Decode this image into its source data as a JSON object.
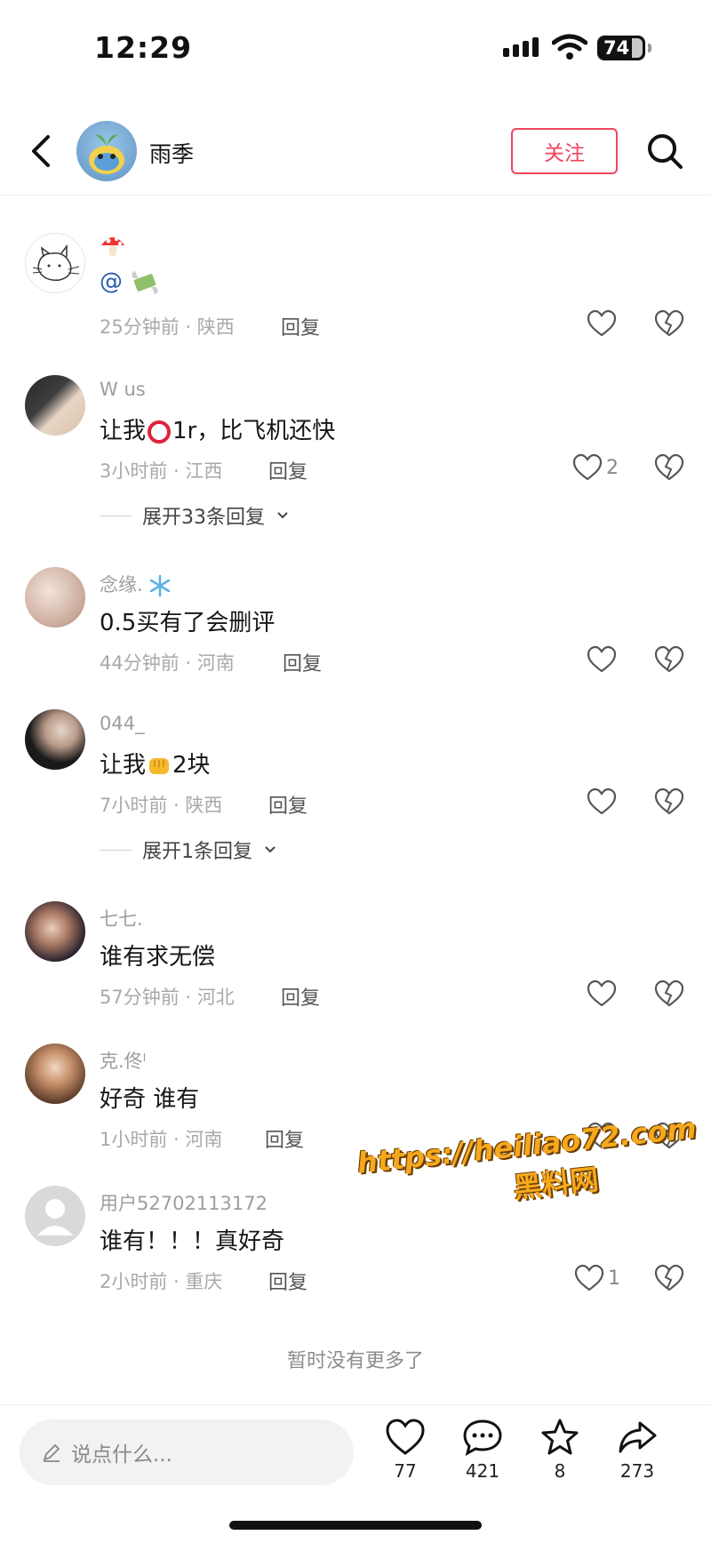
{
  "status_bar": {
    "time": "12:29",
    "battery": "74"
  },
  "header": {
    "username": "雨季",
    "follow_label": "关注"
  },
  "comments": [
    {
      "name": "",
      "text": "@",
      "time_location": "25分钟前 · 陕西",
      "reply_label": "回复",
      "likes": ""
    },
    {
      "name": "W us",
      "text_before": "让我",
      "text_after": "1r，比飞机还快",
      "time_location": "3小时前 · 江西",
      "reply_label": "回复",
      "likes": "2",
      "expand_label": "展开33条回复"
    },
    {
      "name": "念缘.",
      "text": "0.5买有了会删评",
      "time_location": "44分钟前 · 河南",
      "reply_label": "回复",
      "likes": ""
    },
    {
      "name": "044_",
      "text_before": "让我",
      "text_after": "2块",
      "time_location": "7小时前 · 陕西",
      "reply_label": "回复",
      "likes": "",
      "expand_label": "展开1条回复"
    },
    {
      "name": "七七.",
      "text": "谁有求无偿",
      "time_location": "57分钟前 · 河北",
      "reply_label": "回复",
      "likes": ""
    },
    {
      "name": "克.佟ˡ",
      "text": "好奇 谁有",
      "time_location": "1小时前 · 河南",
      "reply_label": "回复",
      "likes": ""
    },
    {
      "name": "用户52702113172",
      "text": "谁有！！！真好奇",
      "time_location": "2小时前 · 重庆",
      "reply_label": "回复",
      "likes": "1"
    }
  ],
  "end_note": "暂时没有更多了",
  "bottom_bar": {
    "input_placeholder": "说点什么...",
    "likes": "77",
    "comments": "421",
    "favorites": "8",
    "shares": "273"
  },
  "watermark": {
    "url": "https://heiliao72.com",
    "name": "黑料网"
  },
  "colors": {
    "accent": "#f0445e",
    "watermark": "#f6a91e"
  }
}
